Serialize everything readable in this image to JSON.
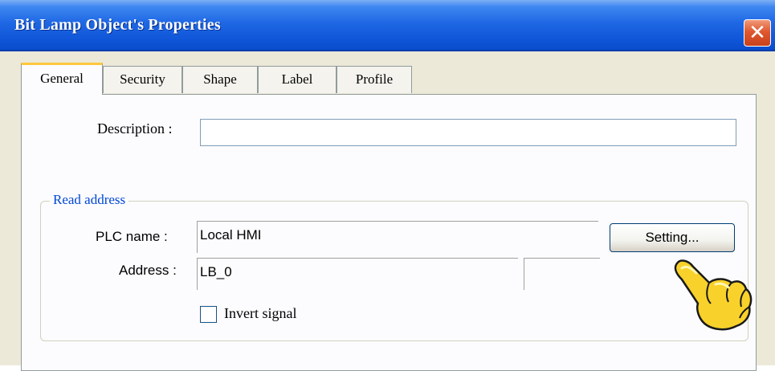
{
  "window": {
    "title": "Bit Lamp Object's Properties"
  },
  "tabs": [
    "General",
    "Security",
    "Shape",
    "Label",
    "Profile"
  ],
  "active_tab": "General",
  "general": {
    "description_label": "Description :",
    "description_value": "",
    "read_address": {
      "title": "Read address",
      "plc_name_label": "PLC name :",
      "plc_name_value": "Local HMI",
      "setting_button": "Setting...",
      "address_label": "Address :",
      "address_value": "LB_0",
      "address_index_value": "",
      "invert_signal_label": "Invert signal",
      "invert_signal_checked": false
    }
  },
  "icons": {
    "close": "close-icon",
    "pointer": "pointing-hand-icon"
  },
  "colors": {
    "titlebar": "#0f55d8",
    "close_button": "#e0582f",
    "group_title": "#0046d5",
    "active_tab_highlight": "#ffc83c"
  }
}
